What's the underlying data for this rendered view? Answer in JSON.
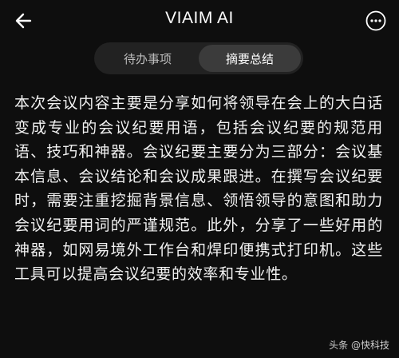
{
  "header": {
    "title": "VIAIM AI"
  },
  "tabs": [
    {
      "label": "待办事项",
      "active": false
    },
    {
      "label": "摘要总结",
      "active": true
    }
  ],
  "summary": {
    "text": "本次会议内容主要是分享如何将领导在会上的大白话变成专业的会议纪要用语，包括会议纪要的规范用语、技巧和神器。会议纪要主要分为三部分：会议基本信息、会议结论和会议成果跟进。在撰写会议纪要时，需要注重挖掘背景信息、领悟领导的意图和助力会议纪要用词的严谨规范。此外，分享了一些好用的神器，如网易境外工作台和焊印便携式打印机。这些工具可以提高会议纪要的效率和专业性。"
  },
  "watermark": {
    "text": "头条 @快科技"
  },
  "colors": {
    "background": "#0e0e0e",
    "tab_bar": "#222222",
    "tab_active": "#3b3b3b",
    "text": "#f2f2f2"
  },
  "icons": {
    "back": "arrow-left-icon",
    "more": "more-horizontal-circle-icon"
  }
}
